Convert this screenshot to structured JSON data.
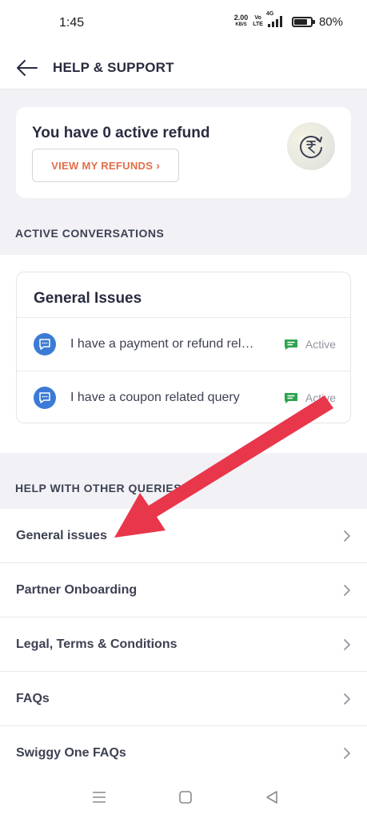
{
  "status_bar": {
    "time": "1:45",
    "net_speed_value": "2.00",
    "net_speed_unit": "KB/S",
    "volte_line1": "Vo",
    "volte_line2": "LTE",
    "network_type": "4G",
    "battery_percent": "80%",
    "battery_level": 0.8
  },
  "header": {
    "title": "HELP & SUPPORT",
    "back_icon": "arrow-left-icon"
  },
  "refund_card": {
    "title": "You have 0 active refund",
    "button_label": "VIEW MY REFUNDS",
    "button_chevron": "›",
    "icon": "rupee-refresh-icon"
  },
  "active_conversations": {
    "section_title": "ACTIVE CONVERSATIONS",
    "card_title": "General Issues",
    "items": [
      {
        "text": "I have a payment or refund related query",
        "status": "Active"
      },
      {
        "text": "I have a coupon related query",
        "status": "Active"
      }
    ]
  },
  "other_queries": {
    "section_title": "HELP WITH OTHER QUERIES",
    "items": [
      {
        "label": "General issues"
      },
      {
        "label": "Partner Onboarding"
      },
      {
        "label": "Legal, Terms & Conditions"
      },
      {
        "label": "FAQs"
      },
      {
        "label": "Swiggy One FAQs"
      }
    ]
  },
  "colors": {
    "accent_orange": "#e46d47",
    "chat_blue": "#3b7bd6",
    "active_green": "#2fa34e",
    "annotation_red": "#e8364b"
  }
}
